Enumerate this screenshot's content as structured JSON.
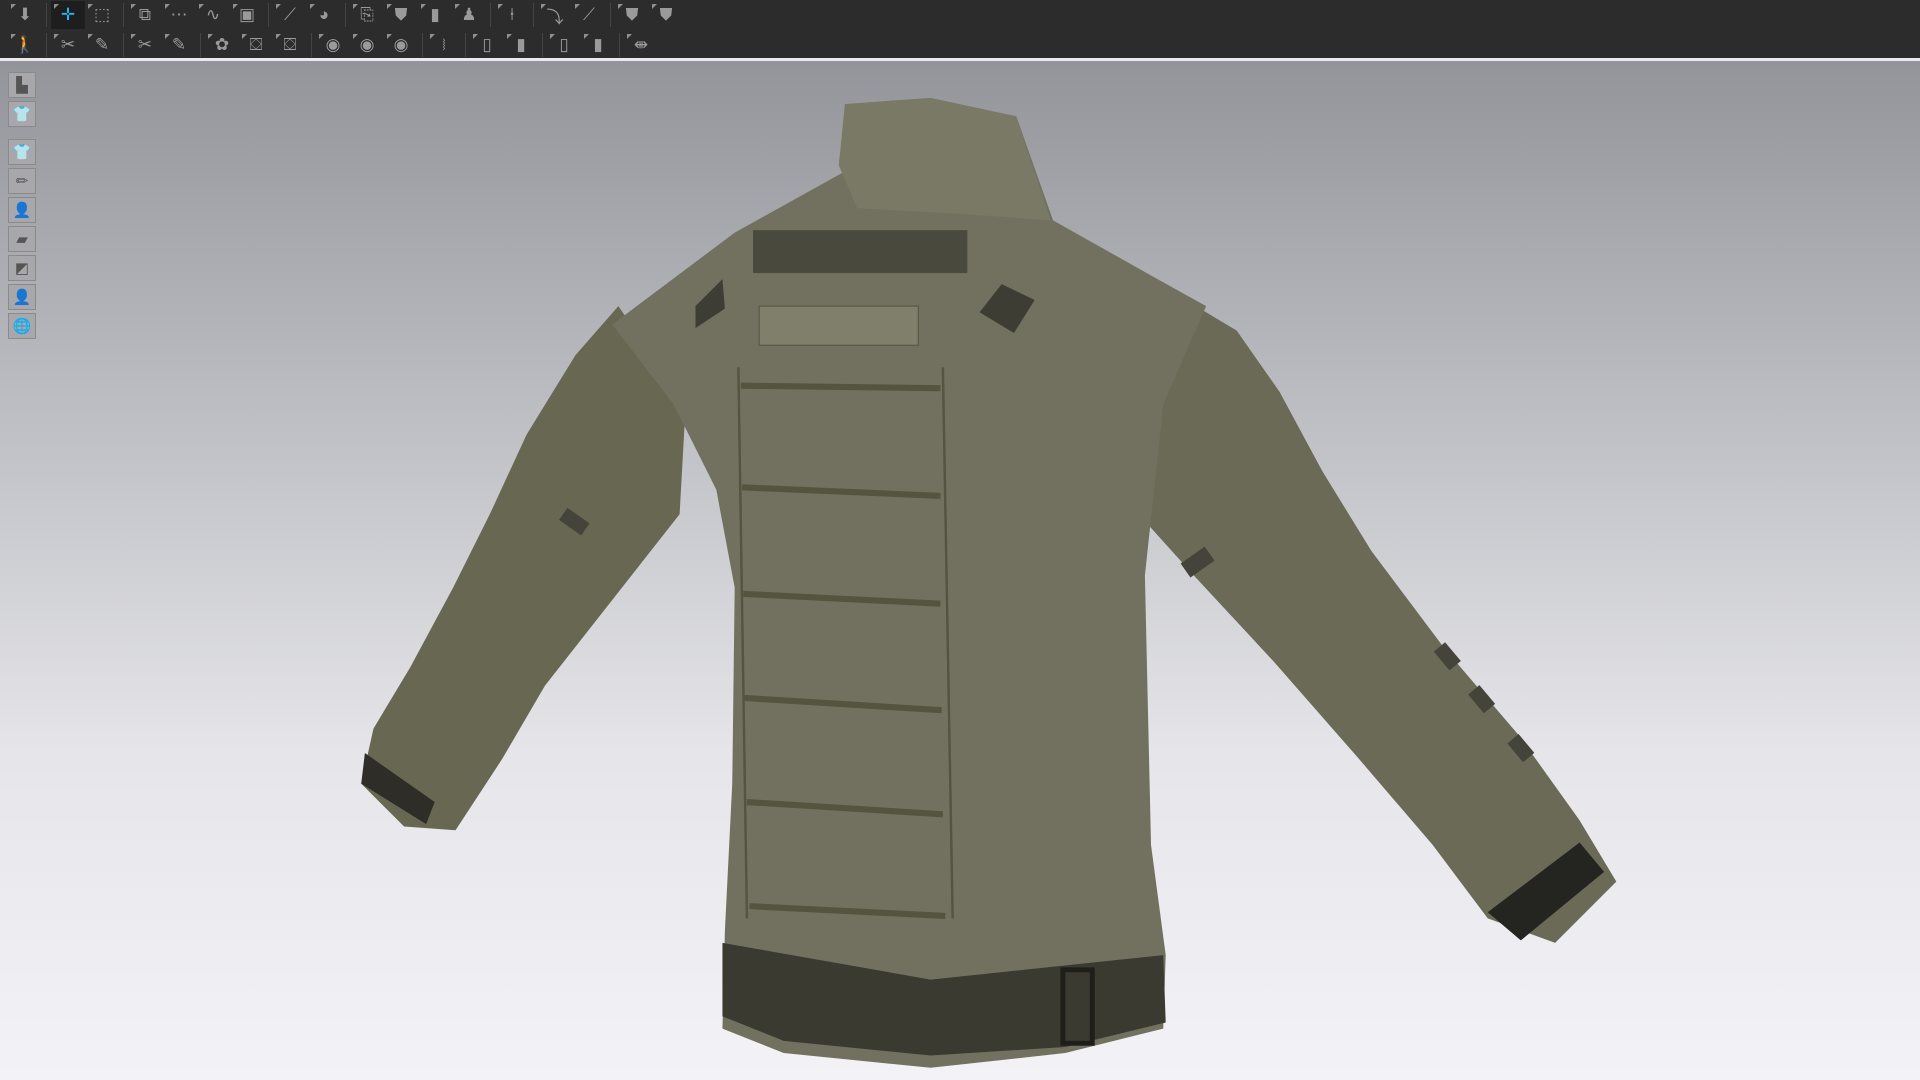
{
  "toolbar": {
    "row1": [
      {
        "name": "simulate-icon",
        "glyph": "⬇"
      },
      {
        "sep": true
      },
      {
        "name": "select-move-icon",
        "glyph": "✛",
        "active": true
      },
      {
        "name": "transform-pattern-icon",
        "glyph": "⬚"
      },
      {
        "sep": true
      },
      {
        "name": "edit-sewing-icon",
        "glyph": "⧉"
      },
      {
        "name": "segment-sewing-icon",
        "glyph": "⋯"
      },
      {
        "name": "free-sewing-icon",
        "glyph": "∿"
      },
      {
        "name": "check-sewing-icon",
        "glyph": "▣"
      },
      {
        "sep": true
      },
      {
        "name": "pin-icon",
        "glyph": "⟋"
      },
      {
        "name": "tack-icon",
        "glyph": "◕"
      },
      {
        "sep": true
      },
      {
        "name": "fold-arrangement-icon",
        "glyph": "⎘"
      },
      {
        "name": "arrange-garment-icon",
        "glyph": "⛊"
      },
      {
        "name": "show-avatar-icon",
        "glyph": "▮"
      },
      {
        "name": "avatar-arrange-icon",
        "glyph": "♟"
      },
      {
        "sep": true
      },
      {
        "name": "measure-garment-icon",
        "glyph": "⍿"
      },
      {
        "sep": true
      },
      {
        "name": "steam-icon",
        "glyph": "⤵"
      },
      {
        "name": "tape-measure-icon",
        "glyph": "⟋"
      },
      {
        "sep": true
      },
      {
        "name": "fitting-suit-icon",
        "glyph": "⛊"
      },
      {
        "name": "strain-map-icon",
        "glyph": "⛊"
      }
    ],
    "row2": [
      {
        "name": "select-mesh-icon",
        "glyph": "🚶"
      },
      {
        "sep": true
      },
      {
        "name": "edit-texture-icon",
        "glyph": "✂"
      },
      {
        "name": "transform-texture-icon",
        "glyph": "✎"
      },
      {
        "sep": true
      },
      {
        "name": "edit-curvature-icon",
        "glyph": "✂"
      },
      {
        "name": "curvature-point-icon",
        "glyph": "✎"
      },
      {
        "sep": true
      },
      {
        "name": "edit-graphic-icon",
        "glyph": "✿"
      },
      {
        "name": "select-graphic-icon",
        "glyph": "⛋"
      },
      {
        "name": "add-graphic-icon",
        "glyph": "⛋"
      },
      {
        "sep": true
      },
      {
        "name": "select-button-icon",
        "glyph": "◉"
      },
      {
        "name": "button-icon",
        "glyph": "◉"
      },
      {
        "name": "buttonhole-icon",
        "glyph": "◉"
      },
      {
        "sep": true
      },
      {
        "name": "zipper-icon",
        "glyph": "⧘"
      },
      {
        "sep": true
      },
      {
        "name": "select-piping-icon",
        "glyph": "▯"
      },
      {
        "name": "piping-icon",
        "glyph": "▮"
      },
      {
        "sep": true
      },
      {
        "name": "select-elastic-icon",
        "glyph": "▯"
      },
      {
        "name": "elastic-icon",
        "glyph": "▮"
      },
      {
        "sep": true
      },
      {
        "name": "topstitch-icon",
        "glyph": "⇼"
      }
    ]
  },
  "left_tools": [
    {
      "name": "show-garment-icon",
      "glyph": "▙"
    },
    {
      "name": "shirt-icon",
      "glyph": "👕"
    },
    {
      "gap": true
    },
    {
      "name": "show-garment-eye-icon",
      "glyph": "👕"
    },
    {
      "name": "show-pins-icon",
      "glyph": "✏"
    },
    {
      "name": "show-avatar-eye-icon",
      "glyph": "👤"
    },
    {
      "name": "show-texture-icon",
      "glyph": "▰"
    },
    {
      "name": "shading-icon",
      "glyph": "◩"
    },
    {
      "name": "avatar-skin-icon",
      "glyph": "👤"
    },
    {
      "name": "show-environment-icon",
      "glyph": "🌐"
    }
  ],
  "colors": {
    "toolbar_bg": "#2c2c2c",
    "accent": "#29b6f6",
    "jacket": "#6d6c58",
    "jacket_dark": "#4e4d3f",
    "belt": "#38372d"
  }
}
